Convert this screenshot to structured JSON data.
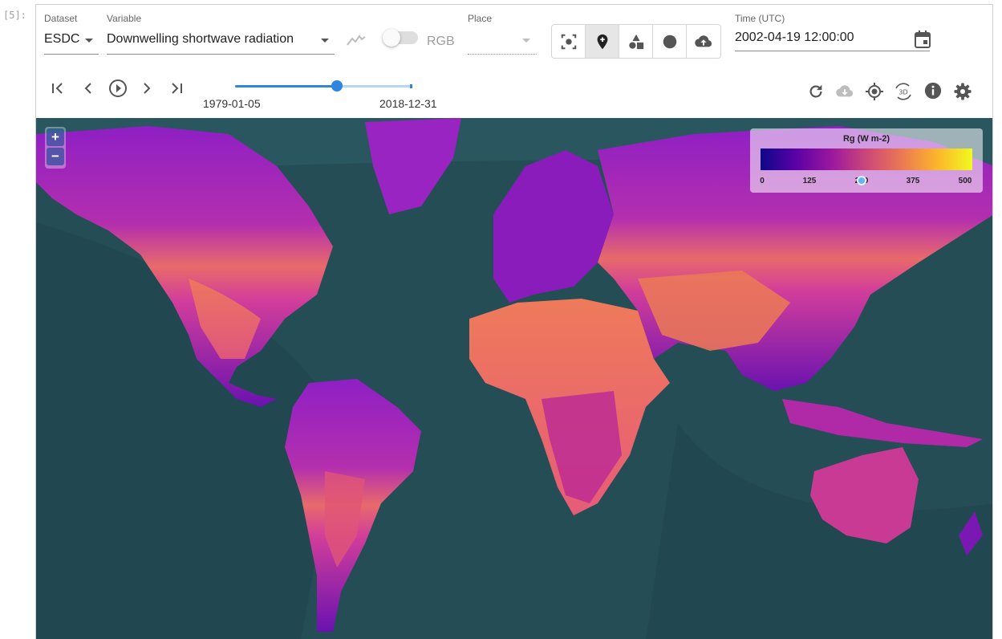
{
  "cell_prompt": "[5]:",
  "toolbar": {
    "dataset": {
      "label": "Dataset",
      "value": "ESDC"
    },
    "variable": {
      "label": "Variable",
      "value": "Downwelling shortwave radiation"
    },
    "rgb_label": "RGB",
    "place": {
      "label": "Place",
      "value": ""
    },
    "time": {
      "label": "Time (UTC)",
      "value": "2002-04-19 12:00:00"
    },
    "tool_buttons": [
      "select-tool",
      "point-tool",
      "polygon-tool",
      "circle-tool",
      "upload-tool"
    ],
    "active_tool": "point-tool"
  },
  "player": {
    "start_date": "1979-01-05",
    "end_date": "2018-12-31",
    "position_fraction": 0.58
  },
  "map_actions": [
    "refresh",
    "cloud-download",
    "locate",
    "3d",
    "info",
    "settings"
  ],
  "legend": {
    "title": "Rg (W m-2)",
    "ticks": [
      "0",
      "125",
      "250",
      "375",
      "500"
    ],
    "colormap": [
      "#0d0887",
      "#5a01a6",
      "#9b179e",
      "#cc4778",
      "#ec7853",
      "#fcb52b",
      "#f0f921"
    ],
    "marker_value": 250
  },
  "zoom": {
    "in_label": "+",
    "out_label": "−"
  },
  "colors": {
    "ocean": "#244d56",
    "accent": "#2e86de"
  }
}
